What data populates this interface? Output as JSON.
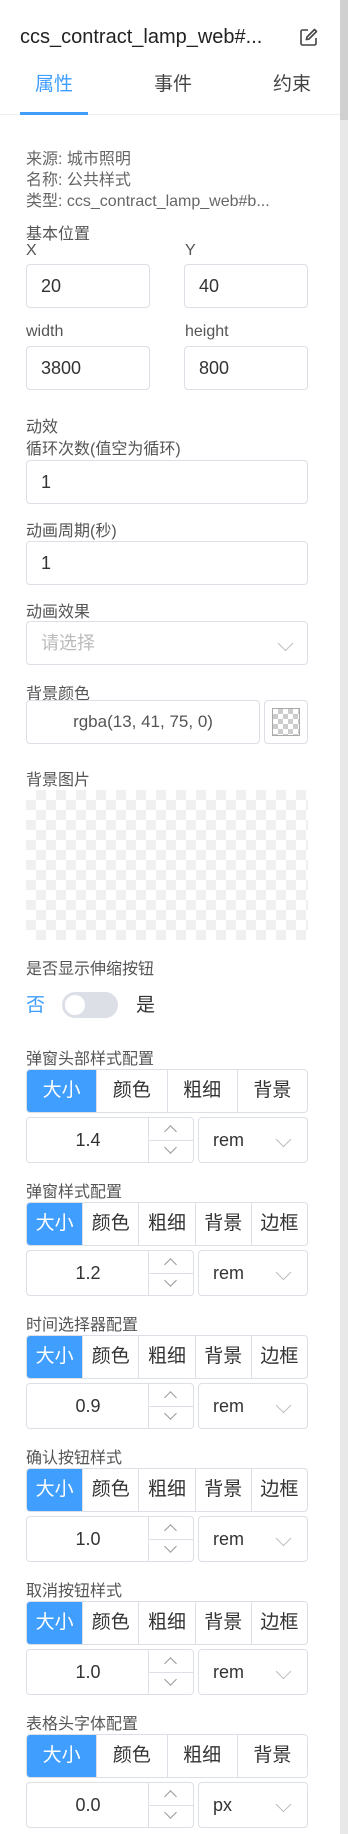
{
  "title": "ccs_contract_lamp_web#...",
  "tabs": [
    "属性",
    "事件",
    "约束"
  ],
  "info": {
    "source": "来源: 城市照明",
    "name": "名称: 公共样式",
    "type": "类型: ccs_contract_lamp_web#b..."
  },
  "position": {
    "section_label": "基本位置",
    "x_label": "X",
    "x_value": "20",
    "y_label": "Y",
    "y_value": "40",
    "width_label": "width",
    "width_value": "3800",
    "height_label": "height",
    "height_value": "800"
  },
  "animation": {
    "section_label": "动效",
    "loop_label": "循环次数(值空为循环)",
    "loop_value": "1",
    "period_label": "动画周期(秒)",
    "period_value": "1",
    "effect_label": "动画效果",
    "effect_placeholder": "请选择"
  },
  "background": {
    "color_label": "背景颜色",
    "color_value": "rgba(13, 41, 75, 0)",
    "image_label": "背景图片"
  },
  "toggle": {
    "label": "是否显示伸缩按钮",
    "off_text": "否",
    "on_text": "是",
    "state": "off"
  },
  "style_groups": [
    {
      "label": "弹窗头部样式配置",
      "segments": [
        "大小",
        "颜色",
        "粗细",
        "背景"
      ],
      "active": 0,
      "value": "1.4",
      "unit": "rem"
    },
    {
      "label": "弹窗样式配置",
      "segments": [
        "大小",
        "颜色",
        "粗细",
        "背景",
        "边框"
      ],
      "active": 0,
      "value": "1.2",
      "unit": "rem"
    },
    {
      "label": "时间选择器配置",
      "segments": [
        "大小",
        "颜色",
        "粗细",
        "背景",
        "边框"
      ],
      "active": 0,
      "value": "0.9",
      "unit": "rem"
    },
    {
      "label": "确认按钮样式",
      "segments": [
        "大小",
        "颜色",
        "粗细",
        "背景",
        "边框"
      ],
      "active": 0,
      "value": "1.0",
      "unit": "rem"
    },
    {
      "label": "取消按钮样式",
      "segments": [
        "大小",
        "颜色",
        "粗细",
        "背景",
        "边框"
      ],
      "active": 0,
      "value": "1.0",
      "unit": "rem"
    },
    {
      "label": "表格头字体配置",
      "segments": [
        "大小",
        "颜色",
        "粗细",
        "背景"
      ],
      "active": 0,
      "value": "0.0",
      "unit": "px"
    }
  ],
  "colors": {
    "accent": "#409eff",
    "border": "#dcdfe6",
    "text": "#333333",
    "muted": "#666666"
  },
  "icons": {
    "edit": "edit-icon",
    "chevron": "chevron-down-icon",
    "stepper_up": "caret-up-icon",
    "stepper_down": "caret-down-icon"
  }
}
